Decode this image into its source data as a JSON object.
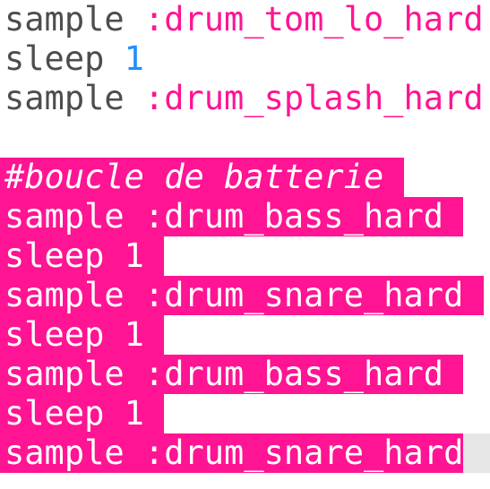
{
  "editor": {
    "lines": [
      {
        "kind": "code",
        "selected": false,
        "keyword": "sample",
        "arg": ":drum_tom_lo_hard",
        "argType": "symbol"
      },
      {
        "kind": "code",
        "selected": false,
        "keyword": "sleep",
        "arg": "1",
        "argType": "number"
      },
      {
        "kind": "code",
        "selected": false,
        "keyword": "sample",
        "arg": ":drum_splash_hard",
        "argType": "symbol"
      },
      {
        "kind": "blank",
        "selected": false
      },
      {
        "kind": "comment",
        "selected": true,
        "text": "#boucle de batterie "
      },
      {
        "kind": "code",
        "selected": true,
        "keyword": "sample",
        "arg": ":drum_bass_hard "
      },
      {
        "kind": "code",
        "selected": true,
        "keyword": "sleep",
        "arg": "1 "
      },
      {
        "kind": "code",
        "selected": true,
        "keyword": "sample",
        "arg": ":drum_snare_hard "
      },
      {
        "kind": "code",
        "selected": true,
        "keyword": "sleep",
        "arg": "1 "
      },
      {
        "kind": "code",
        "selected": true,
        "keyword": "sample",
        "arg": ":drum_bass_hard "
      },
      {
        "kind": "code",
        "selected": true,
        "keyword": "sleep",
        "arg": "1 "
      },
      {
        "kind": "code",
        "selected": true,
        "keyword": "sample",
        "arg": ":drum_snare_hard",
        "cursor": true
      }
    ]
  },
  "colors": {
    "plain": "#4d4d4d",
    "symbol": "#ff1493",
    "number": "#1e90ff",
    "selection": "#ff1493",
    "cursor": "#e6e6e6"
  }
}
